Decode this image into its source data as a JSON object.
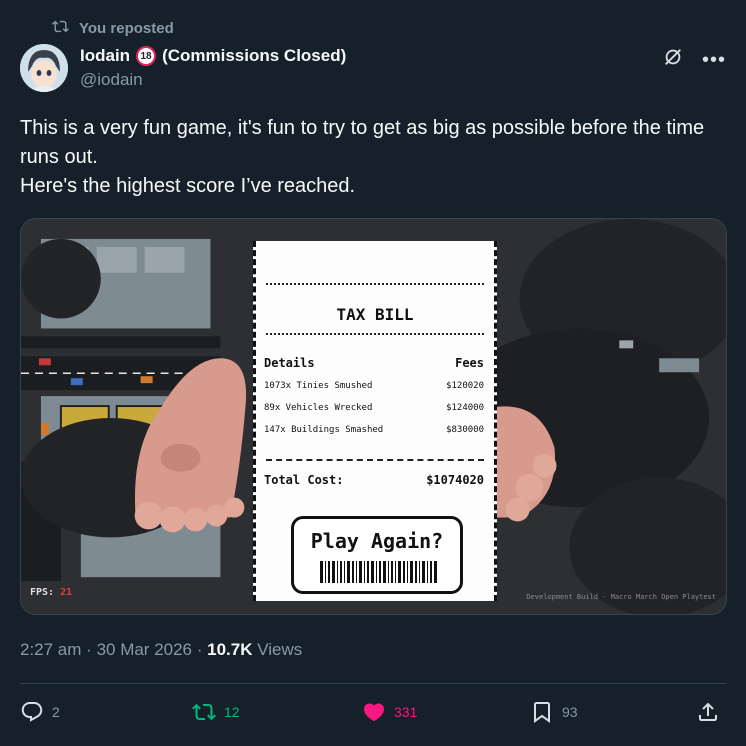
{
  "repost": {
    "label": "You reposted",
    "icon": "repost-icon"
  },
  "author": {
    "name": "Iodain",
    "age_badge": "18",
    "name_suffix": "(Commissions Closed)",
    "handle": "@iodain"
  },
  "tweet": {
    "lines": [
      "This is a very fun game, it's fun to try to get as big as possible before the time runs out.",
      "Here's the highest score I’ve reached."
    ]
  },
  "game": {
    "receipt_title": "TAX BILL",
    "details_header": "Details",
    "fees_header": "Fees",
    "rows": [
      {
        "item": "1073x Tinies Smushed",
        "fee": "$120020"
      },
      {
        "item": "89x Vehicles Wrecked",
        "fee": "$124000"
      },
      {
        "item": "147x Buildings Smashed",
        "fee": "$830000"
      }
    ],
    "total_label": "Total Cost:",
    "total_value": "$1074020",
    "play_again": "Play Again?",
    "fps_label": "FPS:",
    "fps_value": "21",
    "dev_build": "Development Build - Macro March Open Playtest"
  },
  "meta": {
    "time": "2:27 am",
    "date": "30 Mar 2026",
    "views_count": "10.7K",
    "views_label": "Views"
  },
  "actions": {
    "replies": "2",
    "reposts": "12",
    "likes": "331",
    "bookmarks": "93"
  },
  "colors": {
    "background": "#15202b",
    "secondary_text": "#8b98a5",
    "repost_green": "#00ba7c",
    "like_pink": "#f91880",
    "divider": "#38444d"
  }
}
